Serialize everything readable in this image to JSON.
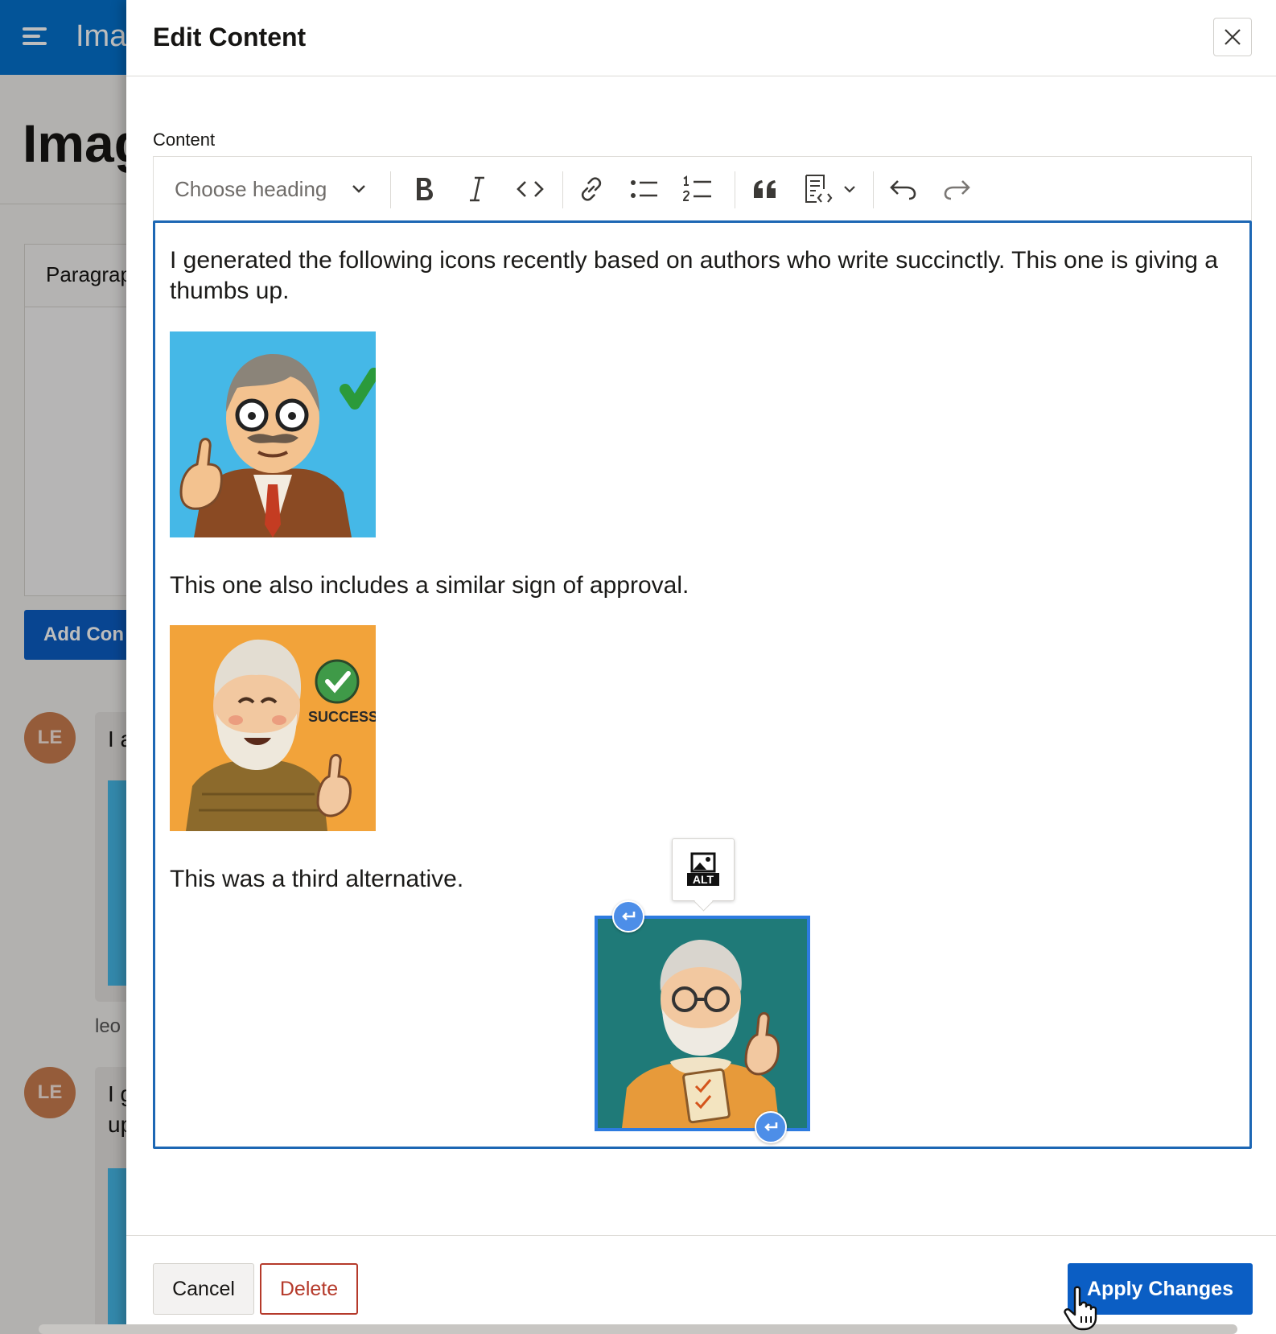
{
  "background": {
    "app_title": "Ima",
    "page_title": "Imag",
    "tab_label": "Paragrap",
    "add_button_label": "Add Con",
    "comments": [
      {
        "initials": "LE",
        "text": "I a"
      },
      {
        "initials": "LE",
        "text": "I g",
        "text2": "up"
      }
    ],
    "author": "leo"
  },
  "dialog": {
    "title": "Edit Content",
    "field_label": "Content",
    "toolbar": {
      "heading_placeholder": "Choose heading"
    },
    "editor": {
      "paragraph_1": "I generated the following icons recently based on authors who write succinctly. This one is giving a thumbs up.",
      "paragraph_2": "This one also includes a similar sign of approval.",
      "paragraph_3": "This was a third alternative.",
      "image_2_badge_text": "SUCCESS!",
      "alt_balloon_text": "ALT"
    },
    "footer": {
      "cancel_label": "Cancel",
      "delete_label": "Delete",
      "apply_label": "Apply Changes"
    }
  },
  "colors": {
    "header_blue": "#0572ce",
    "primary_button": "#0b5ec4",
    "editor_focus_border": "#1d67b4",
    "delete_red": "#b53a2b",
    "image_1_bg": "#45b8e7",
    "image_2_bg": "#f2a33a",
    "image_3_bg": "#1f7a78"
  }
}
